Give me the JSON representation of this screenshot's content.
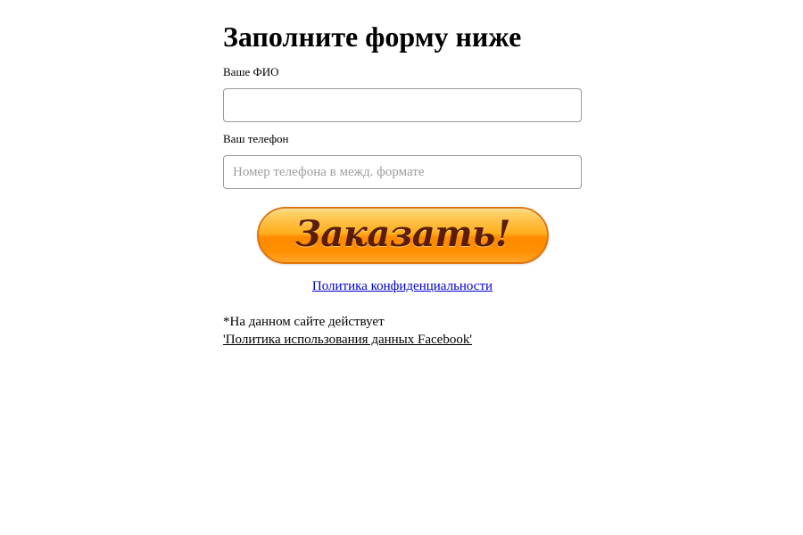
{
  "form": {
    "title": "Заполните форму ниже",
    "name_field": {
      "label": "Ваше ФИО",
      "value": "",
      "placeholder": ""
    },
    "phone_field": {
      "label": "Ваш телефон",
      "value": "",
      "placeholder": "Номер телефона в межд. формате"
    },
    "submit_label": "Заказать!",
    "privacy_link": "Политика конфиденциальности",
    "facebook_note_text": "*На данном сайте действует",
    "facebook_policy_link": "'Политика использования данных Facebook'"
  },
  "colors": {
    "button_orange": "#ff8a00",
    "button_text": "#5a1d0c",
    "link_blue": "#0000cc"
  }
}
